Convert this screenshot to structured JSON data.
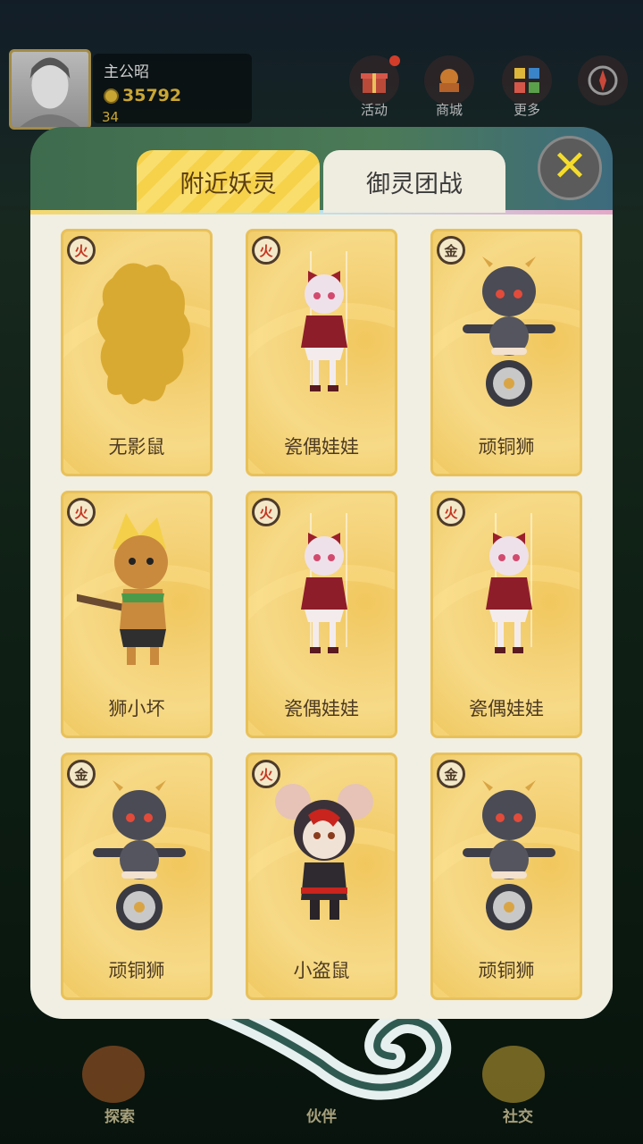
{
  "player": {
    "name": "主公昭",
    "coins": "35792",
    "level": "34"
  },
  "top_buttons": [
    {
      "label": "活动",
      "icon": "gift-icon"
    },
    {
      "label": "商城",
      "icon": "shop-icon"
    },
    {
      "label": "更多",
      "icon": "more-grid-icon"
    },
    {
      "label": "",
      "icon": "compass-icon"
    }
  ],
  "bottom_nav": [
    {
      "label": "探索",
      "icon": "map-pin-icon"
    },
    {
      "label": "伙伴",
      "icon": "partner-icon"
    },
    {
      "label": "社交",
      "icon": "social-icon"
    }
  ],
  "tabs": [
    {
      "label": "附近妖灵",
      "active": true
    },
    {
      "label": "御灵团战",
      "active": false
    }
  ],
  "cards": [
    {
      "name": "无影鼠",
      "element": "火",
      "figure": "silhouette"
    },
    {
      "name": "瓷偶娃娃",
      "element": "火",
      "figure": "doll"
    },
    {
      "name": "顽铜狮",
      "element": "金",
      "figure": "bronze-lion"
    },
    {
      "name": "狮小坏",
      "element": "火",
      "figure": "lion-warrior"
    },
    {
      "name": "瓷偶娃娃",
      "element": "火",
      "figure": "doll"
    },
    {
      "name": "瓷偶娃娃",
      "element": "火",
      "figure": "doll"
    },
    {
      "name": "顽铜狮",
      "element": "金",
      "figure": "bronze-lion"
    },
    {
      "name": "小盗鼠",
      "element": "火",
      "figure": "thief-mouse"
    },
    {
      "name": "顽铜狮",
      "element": "金",
      "figure": "bronze-lion"
    }
  ],
  "close_icon": "close-x-icon",
  "colors": {
    "tab_active": "#f6d24a",
    "card": "#f4d279",
    "close_x": "#f5dc2a",
    "fire": "#c63420"
  }
}
